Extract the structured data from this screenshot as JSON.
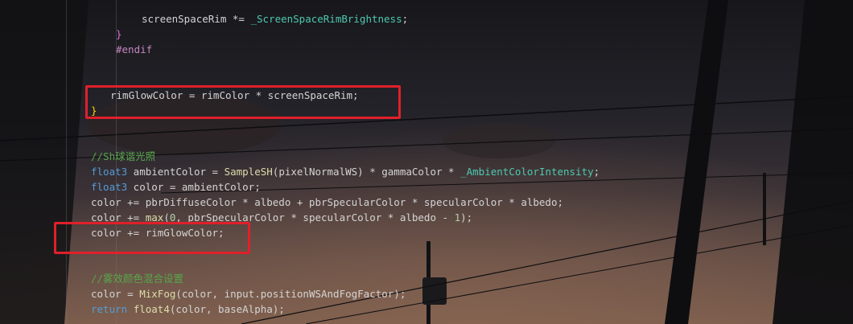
{
  "editor": {
    "lines": [
      {
        "tokens": [
          {
            "t": "screenSpaceRim *= ",
            "c": "plain"
          },
          {
            "t": "_ScreenSpaceRimBrightness",
            "c": "var"
          },
          {
            "t": ";",
            "c": "plain"
          }
        ]
      },
      {
        "tokens": [
          {
            "t": "}",
            "c": "brace2"
          }
        ]
      },
      {
        "tokens": [
          {
            "t": "#endif",
            "c": "macro"
          }
        ]
      },
      {
        "tokens": [
          {
            "t": "rimGlowColor = rimColor * screenSpaceRim;",
            "c": "plain"
          }
        ]
      },
      {
        "tokens": [
          {
            "t": "}",
            "c": "brace"
          }
        ]
      },
      {
        "tokens": [
          {
            "t": "//Sh球谐光照",
            "c": "comment"
          }
        ]
      },
      {
        "tokens": [
          {
            "t": "float3",
            "c": "type"
          },
          {
            "t": " ambientColor = ",
            "c": "plain"
          },
          {
            "t": "SampleSH",
            "c": "func"
          },
          {
            "t": "(pixelNormalWS) * gammaColor * ",
            "c": "plain"
          },
          {
            "t": "_AmbientColorIntensity",
            "c": "var"
          },
          {
            "t": ";",
            "c": "plain"
          }
        ]
      },
      {
        "tokens": [
          {
            "t": "float3",
            "c": "type"
          },
          {
            "t": " color = ambientColor;",
            "c": "plain"
          }
        ]
      },
      {
        "tokens": [
          {
            "t": "color += pbrDiffuseColor * albedo + pbrSpecularColor * specularColor * albedo;",
            "c": "plain"
          }
        ]
      },
      {
        "tokens": [
          {
            "t": "color += ",
            "c": "plain"
          },
          {
            "t": "max",
            "c": "func"
          },
          {
            "t": "(",
            "c": "plain"
          },
          {
            "t": "0",
            "c": "num"
          },
          {
            "t": ", pbrSpecularColor * specularColor * albedo - ",
            "c": "plain"
          },
          {
            "t": "1",
            "c": "num"
          },
          {
            "t": ");",
            "c": "plain"
          }
        ]
      },
      {
        "tokens": [
          {
            "t": "color += rimGlowColor;",
            "c": "plain"
          }
        ]
      },
      {
        "tokens": [
          {
            "t": "//雾效颜色混合设置",
            "c": "comment"
          }
        ]
      },
      {
        "tokens": [
          {
            "t": "color = ",
            "c": "plain"
          },
          {
            "t": "MixFog",
            "c": "func"
          },
          {
            "t": "(color, input.positionWSAndFogFactor);",
            "c": "plain"
          }
        ]
      },
      {
        "tokens": [
          {
            "t": "return",
            "c": "type"
          },
          {
            "t": " ",
            "c": "plain"
          },
          {
            "t": "float4",
            "c": "func"
          },
          {
            "t": "(color, baseAlpha);",
            "c": "plain"
          }
        ]
      }
    ]
  }
}
